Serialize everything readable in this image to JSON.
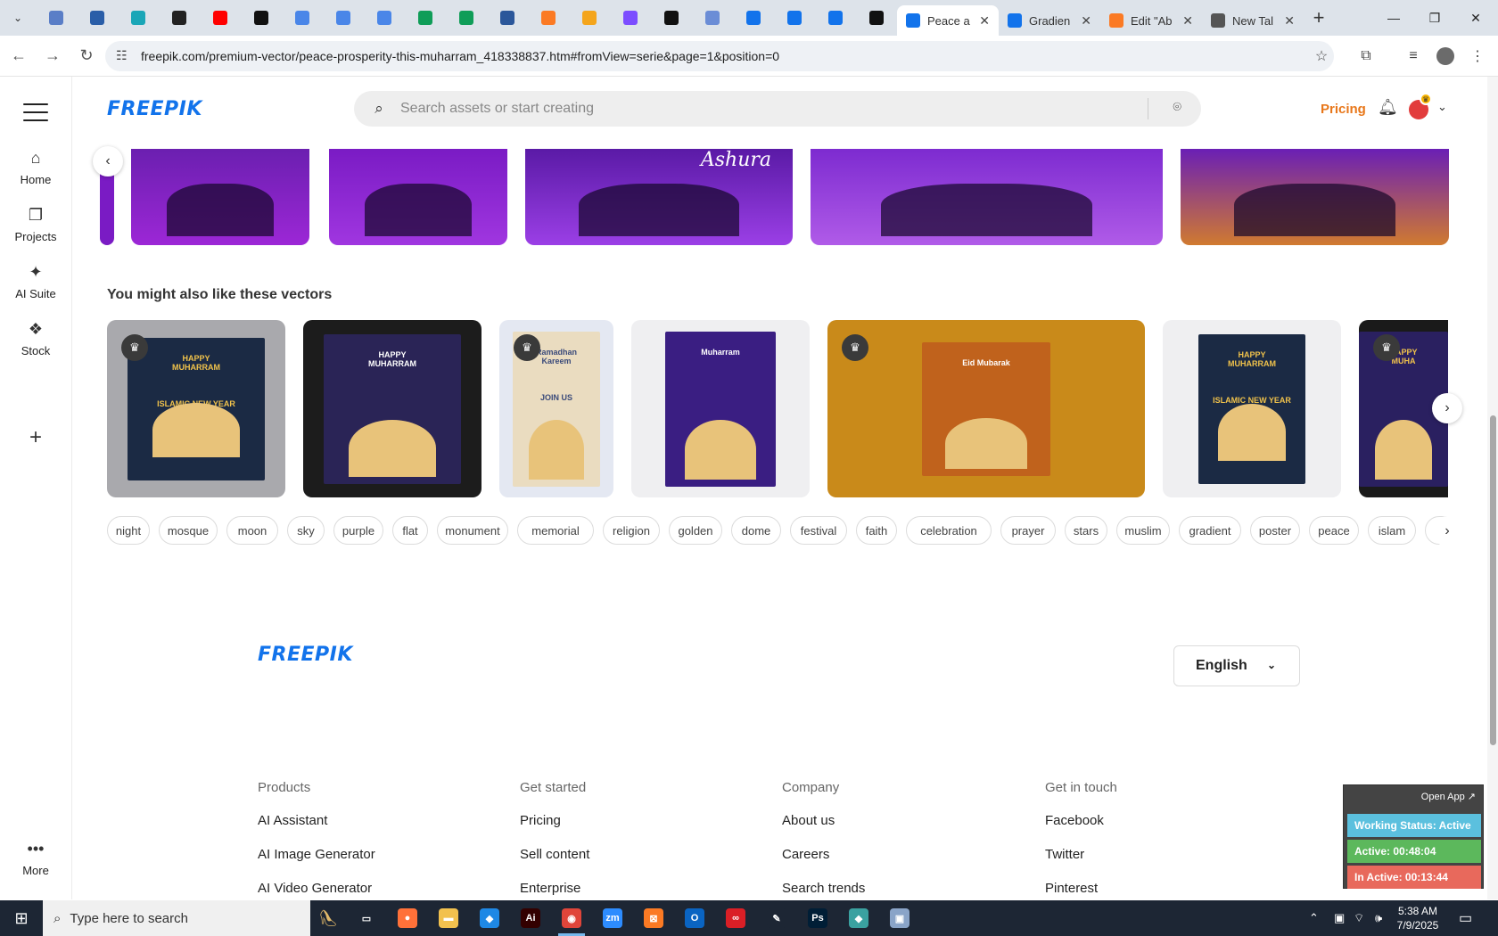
{
  "browser": {
    "pinned_tabs": [
      {
        "icon": "app-favicon",
        "color": "#5a7ec7"
      },
      {
        "icon": "vpn-favicon",
        "color": "#2a5ea8"
      },
      {
        "icon": "arrow-favicon",
        "color": "#1aa6b7"
      },
      {
        "icon": "openai-favicon",
        "color": "#222222"
      },
      {
        "icon": "youtube-favicon",
        "color": "#ff0000"
      },
      {
        "icon": "bolt-favicon",
        "color": "#111111"
      },
      {
        "icon": "docs-favicon",
        "color": "#4a86e8"
      },
      {
        "icon": "docs-favicon",
        "color": "#4a86e8"
      },
      {
        "icon": "docs-favicon",
        "color": "#4a86e8"
      },
      {
        "icon": "sheets-favicon",
        "color": "#0f9d58"
      },
      {
        "icon": "sheets-favicon",
        "color": "#0f9d58"
      },
      {
        "icon": "word-favicon",
        "color": "#2b579a"
      },
      {
        "icon": "xampp-favicon",
        "color": "#fb7a24"
      },
      {
        "icon": "bird-favicon",
        "color": "#f4a51c"
      },
      {
        "icon": "braces-favicon",
        "color": "#7c4dff"
      },
      {
        "icon": "a-favicon",
        "color": "#111111"
      },
      {
        "icon": "grid-favicon",
        "color": "#6b8dd6"
      },
      {
        "icon": "freepik-favicon",
        "color": "#1273eb"
      },
      {
        "icon": "freepik-favicon",
        "color": "#1273eb"
      },
      {
        "icon": "freepik-favicon",
        "color": "#1273eb"
      },
      {
        "icon": "m-favicon",
        "color": "#111111"
      }
    ],
    "tabs": [
      {
        "label": "Peace a",
        "active": true,
        "icon": "freepik-favicon",
        "color": "#1273eb"
      },
      {
        "label": "Gradien",
        "active": false,
        "icon": "freepik-favicon",
        "color": "#1273eb"
      },
      {
        "label": "Edit \"Ab",
        "active": false,
        "icon": "xampp-favicon",
        "color": "#fb7a24"
      },
      {
        "label": "New Tal",
        "active": false,
        "icon": "chrome-favicon",
        "color": "#555555"
      }
    ],
    "url": "freepik.com/premium-vector/peace-prosperity-this-muharram_418338837.htm#fromView=serie&page=1&position=0"
  },
  "freepik": {
    "logo": "FREEPIK",
    "search_placeholder": "Search assets or start creating",
    "pricing": "Pricing",
    "sidebar": [
      {
        "label": "Home",
        "icon": "home-icon"
      },
      {
        "label": "Projects",
        "icon": "projects-icon"
      },
      {
        "label": "AI Suite",
        "icon": "sparkle-icon"
      },
      {
        "label": "Stock",
        "icon": "stock-icon"
      }
    ],
    "more": "More",
    "top_images": [
      {
        "color_a": "#6b1fb0",
        "color_b": "#9c27d6"
      },
      {
        "color_a": "#7a1bc4",
        "color_b": "#a036e0"
      },
      {
        "color_a": "#5a1aa6",
        "color_b": "#9b3fe6",
        "text": "Ashura"
      },
      {
        "color_a": "#7d2bd0",
        "color_b": "#b05be8"
      },
      {
        "color_a": "#6a1fb5",
        "color_b": "#d07a30"
      }
    ],
    "section_title": "You might also like these vectors",
    "cards": [
      {
        "bg": "#a9a9ad",
        "premium": true,
        "poster_bg": "#1b2a44",
        "text": "HAPPY\nMUHARRAM\n\n\n\nISLAMIC NEW YEAR\n1443 AH",
        "text_color": "#f0c24b"
      },
      {
        "bg": "#1c1c1c",
        "premium": false,
        "poster_bg": "#2a2456",
        "text": "HAPPY\nMUHARRAM",
        "text_color": "#ffffff"
      },
      {
        "bg": "#e4e8f2",
        "premium": true,
        "poster_bg": "#eadcc0",
        "text": "Ramadhan\nKareem\n\n\n\nJOIN US",
        "text_color": "#3a4a7a"
      },
      {
        "bg": "#efeff1",
        "premium": false,
        "poster_bg": "#3a1e82",
        "text": "Muharram",
        "text_color": "#ffffff"
      },
      {
        "bg": "#c98a1a",
        "premium": true,
        "poster_bg": "#c0621c",
        "text": "Eid Mubarak",
        "text_color": "#ffffff"
      },
      {
        "bg": "#efeff1",
        "premium": false,
        "poster_bg": "#1b2a44",
        "text": "HAPPY\nMUHARRAM\n\n\n\nISLAMIC NEW YEAR\n1443 AH",
        "text_color": "#f0c24b"
      },
      {
        "bg": "#1a1a1a",
        "premium": true,
        "poster_bg": "#2a2060",
        "text": "HAPPY\nMUHA",
        "text_color": "#f0c24b"
      }
    ],
    "tags": [
      "night",
      "mosque",
      "moon",
      "sky",
      "purple",
      "flat",
      "monument",
      "memorial",
      "religion",
      "golden",
      "dome",
      "festival",
      "faith",
      "celebration",
      "prayer",
      "stars",
      "muslim",
      "gradient",
      "poster",
      "peace",
      "islam",
      "m"
    ],
    "language": "English",
    "footer": {
      "columns": [
        {
          "title": "Products",
          "links": [
            "AI Assistant",
            "AI Image Generator",
            "AI Video Generator"
          ]
        },
        {
          "title": "Get started",
          "links": [
            "Pricing",
            "Sell content",
            "Enterprise"
          ]
        },
        {
          "title": "Company",
          "links": [
            "About us",
            "Careers",
            "Search trends"
          ]
        },
        {
          "title": "Get in touch",
          "links": [
            "Facebook",
            "Twitter",
            "Pinterest"
          ]
        }
      ]
    }
  },
  "widget": {
    "open_app": "Open App",
    "status": "Working Status: Active",
    "active": "Active: 00:48:04",
    "inactive": "In Active: 00:13:44",
    "colors": {
      "status": "#5bc0de",
      "active": "#5cb85c",
      "inactive": "#e8695c"
    }
  },
  "taskbar": {
    "search_placeholder": "Type here to search",
    "apps": [
      {
        "icon": "task-view-icon",
        "color": "#1d2634",
        "text": "▭"
      },
      {
        "icon": "firefox-icon",
        "color": "#ff7139",
        "text": "●"
      },
      {
        "icon": "file-explorer-icon",
        "color": "#f2c14e",
        "text": "▬"
      },
      {
        "icon": "vscode-icon",
        "color": "#1e88e5",
        "text": "◆"
      },
      {
        "icon": "illustrator-icon",
        "color": "#330000",
        "text": "Ai"
      },
      {
        "icon": "chrome-icon",
        "color": "#e0453a",
        "text": "◉",
        "active": true
      },
      {
        "icon": "zoom-icon",
        "color": "#2d8cff",
        "text": "zm"
      },
      {
        "icon": "xampp-icon",
        "color": "#fb7a24",
        "text": "⊠"
      },
      {
        "icon": "outlook-icon",
        "color": "#0a64c2",
        "text": "O"
      },
      {
        "icon": "creative-cloud-icon",
        "color": "#da1f26",
        "text": "∞"
      },
      {
        "icon": "pen-tool-icon",
        "color": "#1d2634",
        "text": "✎"
      },
      {
        "icon": "photoshop-icon",
        "color": "#001e36",
        "text": "Ps"
      },
      {
        "icon": "app-icon",
        "color": "#3aa1a0",
        "text": "◆"
      },
      {
        "icon": "screen-icon",
        "color": "#8aa4c8",
        "text": "▣"
      }
    ],
    "time": "5:38 AM",
    "date": "7/9/2025"
  }
}
